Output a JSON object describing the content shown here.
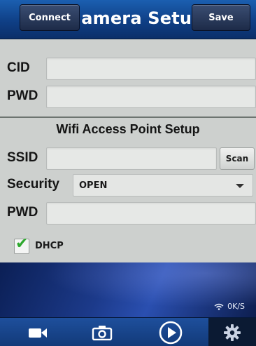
{
  "header": {
    "connect_label": "Connect",
    "title": "Camera Setup",
    "save_label": "Save"
  },
  "camera": {
    "cid_label": "CID",
    "cid_value": "",
    "pwd_label": "PWD",
    "pwd_value": ""
  },
  "wifi": {
    "section_title": "Wifi Access Point Setup",
    "ssid_label": "SSID",
    "ssid_value": "",
    "scan_label": "Scan",
    "security_label": "Security",
    "security_value": "OPEN",
    "pwd_label": "PWD",
    "pwd_value": "",
    "dhcp_label": "DHCP",
    "dhcp_checked": true
  },
  "status": {
    "rate": "0K/S"
  },
  "nav": {
    "items": [
      {
        "icon": "video-camera-icon"
      },
      {
        "icon": "camera-icon"
      },
      {
        "icon": "play-icon"
      },
      {
        "icon": "gear-icon",
        "active": true
      }
    ]
  },
  "colors": {
    "header_blue": "#0f3f86",
    "form_bg": "#cdd0ce",
    "check_green": "#2da82d"
  }
}
